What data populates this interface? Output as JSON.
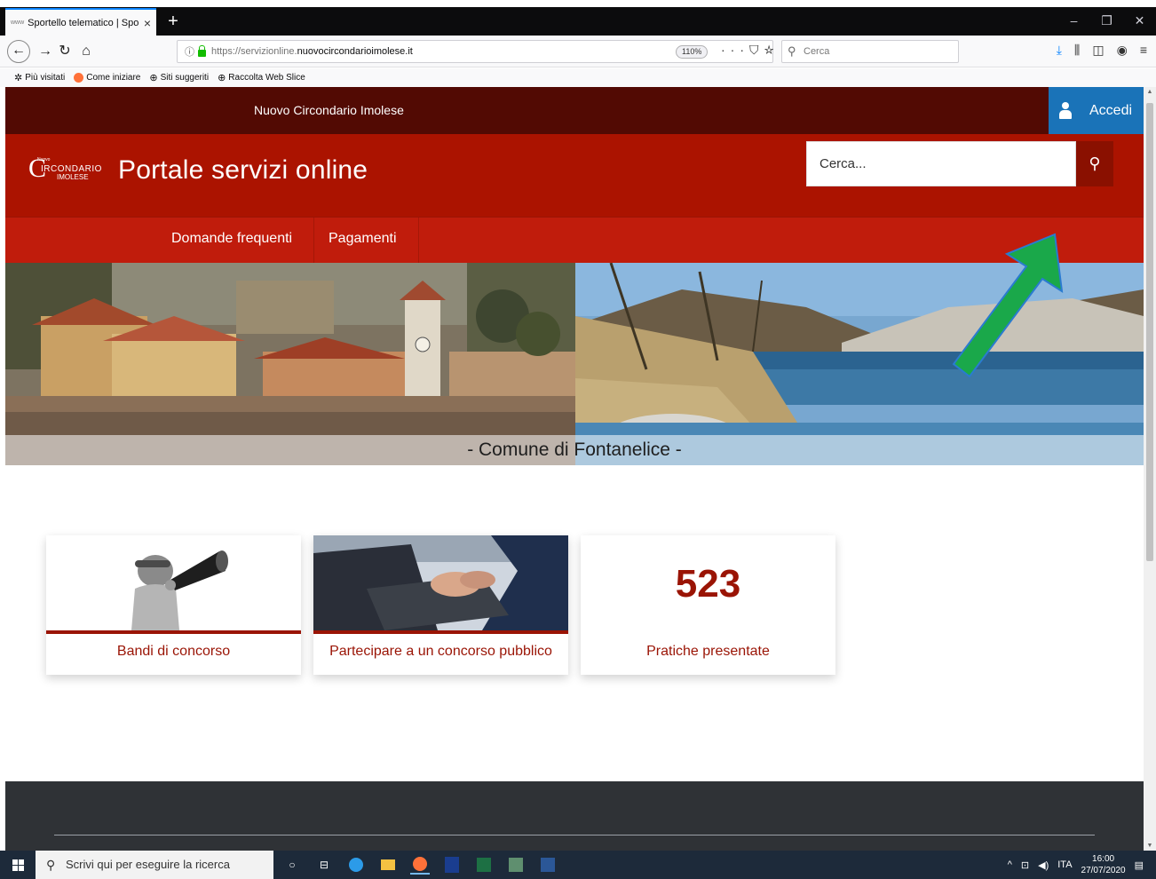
{
  "browser": {
    "tab_title": "Sportello telematico | Sportello",
    "tab_favicon": "www",
    "url_prefix": "https://servizionline.",
    "url_domain": "nuovocircondarioimolese.it",
    "zoom": "110%",
    "search_placeholder": "Cerca",
    "bookmarks": [
      "Più visitati",
      "Come iniziare",
      "Siti suggeriti",
      "Raccolta Web Slice"
    ]
  },
  "site": {
    "org_name": "Nuovo Circondario Imolese",
    "login_label": "Accedi",
    "logo_small": "Nuovo",
    "logo_main": "IRCONDARIO",
    "logo_sub": "IMOLESE",
    "portal_title": "Portale servizi online",
    "search_placeholder": "Cerca...",
    "menu": [
      "Domande frequenti",
      "Pagamenti"
    ],
    "hero_caption": "- Comune di Fontanelice -",
    "cards": [
      {
        "label": "Bandi di concorso"
      },
      {
        "label": "Partecipare a un concorso pubblico"
      },
      {
        "number": "523",
        "label": "Pratiche presentate"
      }
    ]
  },
  "taskbar": {
    "search_placeholder": "Scrivi qui per eseguire la ricerca",
    "lang": "ITA",
    "time": "16:00",
    "date": "27/07/2020"
  },
  "colors": {
    "dark_red": "#520a03",
    "brand_red": "#ab1300",
    "menu_red": "#c01c0c",
    "login_blue": "#1a73b8",
    "annotation_arrow": "#1aa84a"
  }
}
